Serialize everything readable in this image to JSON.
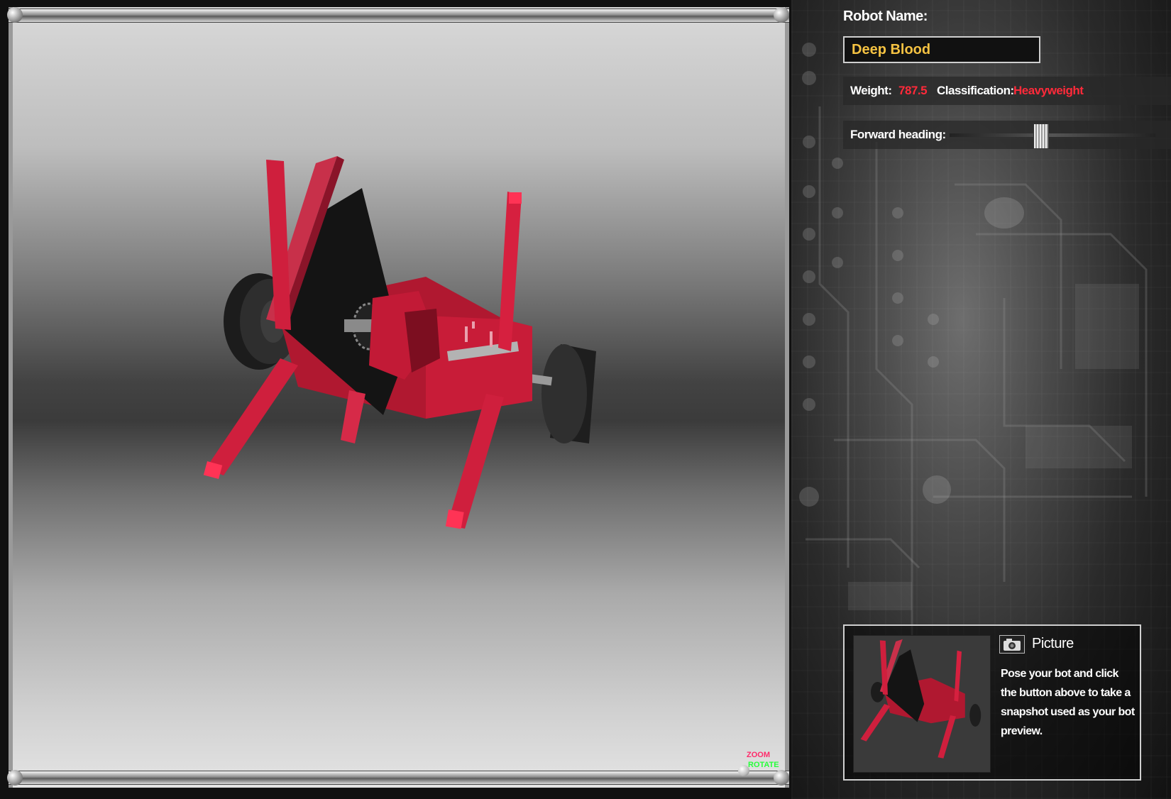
{
  "robot_name": {
    "label": "Robot Name:",
    "value": "Deep Blood"
  },
  "stats": {
    "weight_label": "Weight:",
    "weight_value": "787.5",
    "classification_label": "Classification:",
    "classification_value": "Heavyweight"
  },
  "heading": {
    "label": "Forward heading:",
    "slider_fraction": 0.44
  },
  "picture": {
    "title": "Picture",
    "description": "Pose your bot and click the button above to take a snapshot used as your bot preview."
  },
  "zoom_control": {
    "zoom_label": "ZOOM",
    "rotate_label": "ROTATE"
  },
  "colors": {
    "robot_red": "#d0203c",
    "value_red": "#ff2a3a",
    "name_gold": "#f5c242",
    "rotate_green": "#27ff3b"
  },
  "icons": {
    "camera": "camera-icon"
  }
}
